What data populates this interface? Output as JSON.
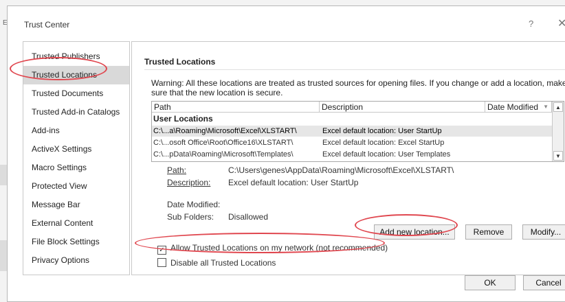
{
  "background": {
    "label": "Ex"
  },
  "dialog": {
    "title": "Trust Center",
    "help_glyph": "?",
    "close_glyph": "✕"
  },
  "nav": {
    "items": [
      {
        "label": "Trusted Publishers",
        "selected": false
      },
      {
        "label": "Trusted Locations",
        "selected": true
      },
      {
        "label": "Trusted Documents",
        "selected": false
      },
      {
        "label": "Trusted Add-in Catalogs",
        "selected": false
      },
      {
        "label": "Add-ins",
        "selected": false
      },
      {
        "label": "ActiveX Settings",
        "selected": false
      },
      {
        "label": "Macro Settings",
        "selected": false
      },
      {
        "label": "Protected View",
        "selected": false
      },
      {
        "label": "Message Bar",
        "selected": false
      },
      {
        "label": "External Content",
        "selected": false
      },
      {
        "label": "File Block Settings",
        "selected": false
      },
      {
        "label": "Privacy Options",
        "selected": false
      }
    ]
  },
  "content": {
    "section_title": "Trusted Locations",
    "warning": "Warning: All these locations are treated as trusted sources for opening files.  If you change or add a location, make sure that the new location is secure.",
    "table": {
      "columns": [
        "Path",
        "Description",
        "Date Modified"
      ],
      "sort_glyph": "▼",
      "group_label": "User Locations",
      "rows": [
        {
          "path": "C:\\...a\\Roaming\\Microsoft\\Excel\\XLSTART\\",
          "description": "Excel default location: User StartUp",
          "date": "",
          "selected": true
        },
        {
          "path": "C:\\...osoft Office\\Root\\Office16\\XLSTART\\",
          "description": "Excel default location: Excel StartUp",
          "date": "",
          "selected": false
        },
        {
          "path": "C:\\...pData\\Roaming\\Microsoft\\Templates\\",
          "description": "Excel default location: User Templates",
          "date": "",
          "selected": false
        }
      ],
      "scroll_up_glyph": "▲",
      "scroll_down_glyph": "▼"
    },
    "details": {
      "path_label": "Path:",
      "path_value": "C:\\Users\\genes\\AppData\\Roaming\\Microsoft\\Excel\\XLSTART\\",
      "description_label": "Description:",
      "description_value": "Excel default location: User StartUp",
      "date_modified_label": "Date Modified:",
      "date_modified_value": "",
      "subfolders_label": "Sub Folders:",
      "subfolders_value": "Disallowed"
    },
    "buttons": {
      "add": "Add new location...",
      "remove": "Remove",
      "modify": "Modify..."
    },
    "options": {
      "allow_network_label": "Allow Trusted Locations on my network (not recommended)",
      "allow_network_checked": true,
      "disable_all_label": "Disable all Trusted Locations",
      "disable_all_checked": false
    }
  },
  "footer": {
    "ok": "OK",
    "cancel": "Cancel"
  },
  "colors": {
    "annotation": "#e0474f",
    "selected_nav": "#d9d9d9"
  }
}
